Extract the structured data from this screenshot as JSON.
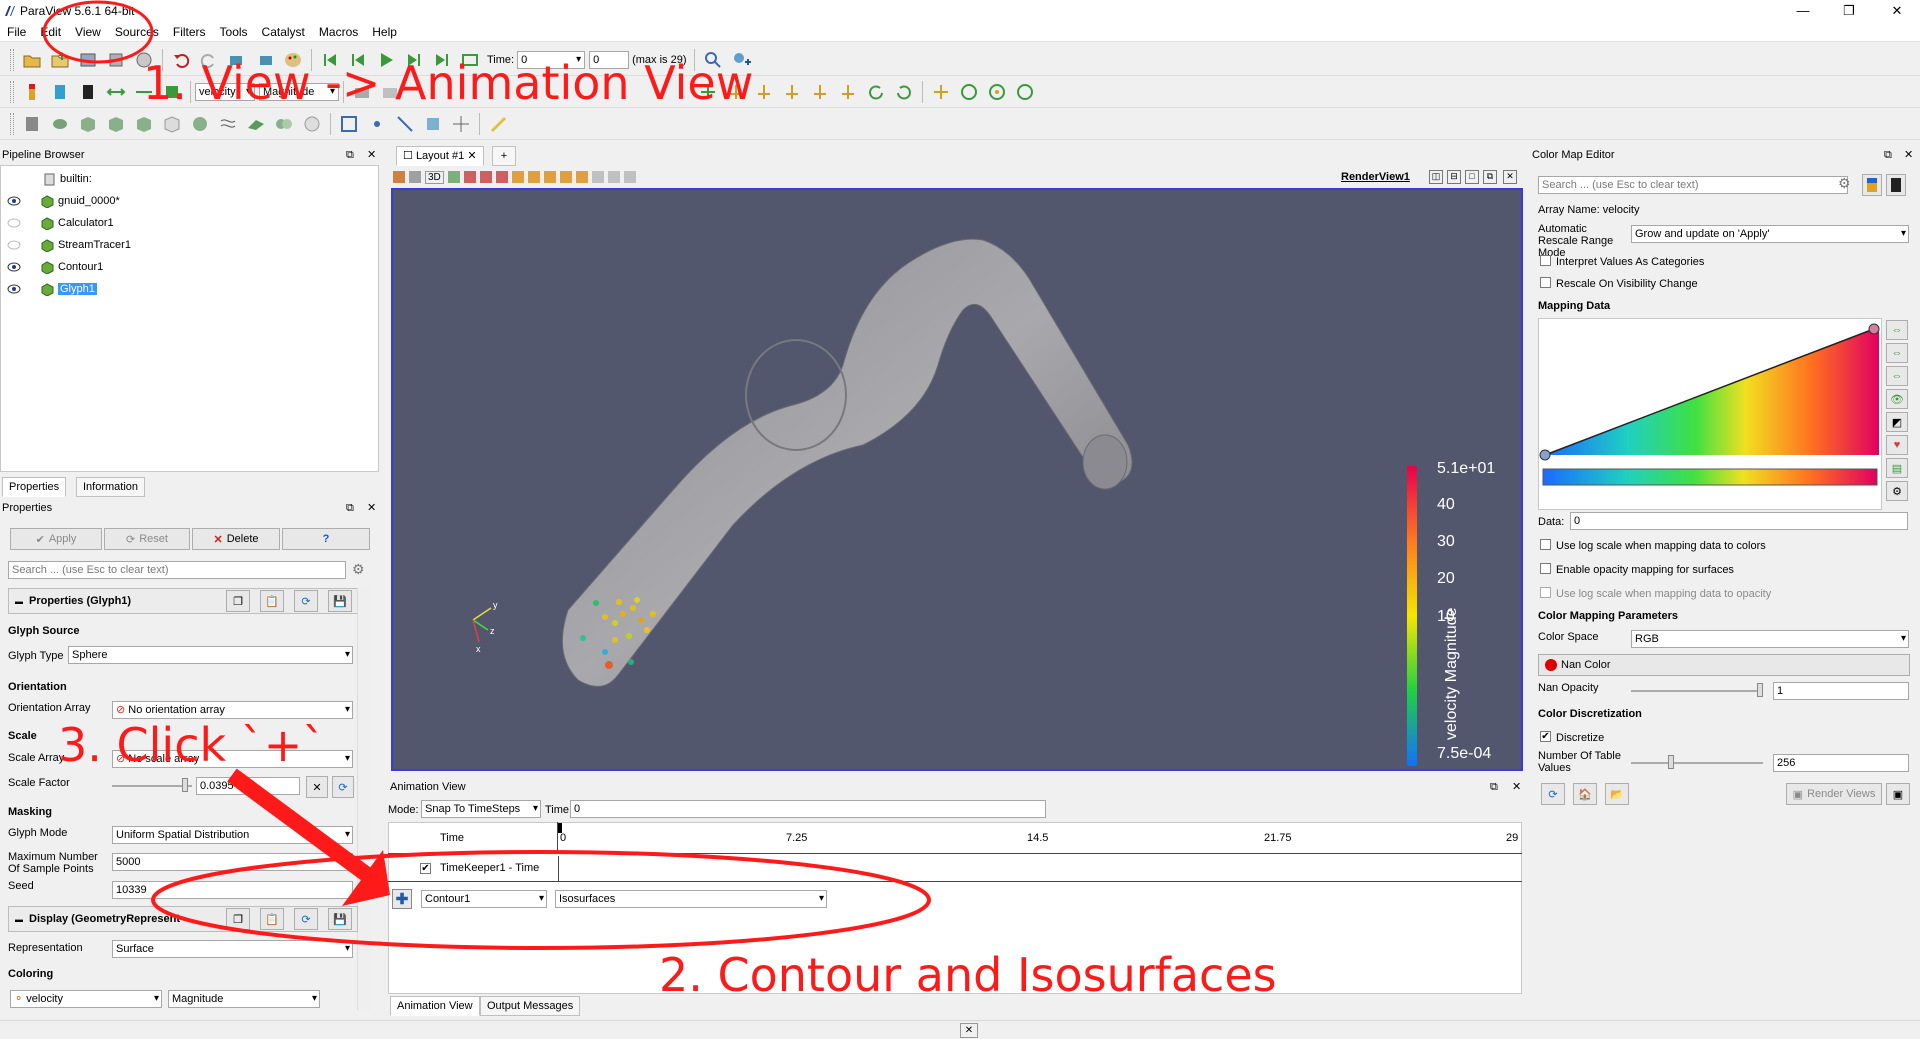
{
  "window": {
    "title": "ParaView 5.6.1 64-bit",
    "controls": [
      "—",
      "❐",
      "✕"
    ]
  },
  "menu": [
    "File",
    "Edit",
    "View",
    "Sources",
    "Filters",
    "Tools",
    "Catalyst",
    "Macros",
    "Help"
  ],
  "toolbar": {
    "time_label": "Time:",
    "time_value": "0",
    "timestep_value": "0",
    "max_label": "(max is 29)",
    "color_combo": "Magnitude"
  },
  "pipeline": {
    "title": "Pipeline Browser",
    "items": [
      {
        "label": "builtin:",
        "visible": null
      },
      {
        "label": "gnuid_0000*",
        "visible": true
      },
      {
        "label": "Calculator1",
        "visible": false
      },
      {
        "label": "StreamTracer1",
        "visible": false
      },
      {
        "label": "Contour1",
        "visible": true
      },
      {
        "label": "Glyph1",
        "visible": true,
        "selected": true
      }
    ]
  },
  "properties": {
    "tabs": [
      "Properties",
      "Information"
    ],
    "title": "Properties",
    "apply": "Apply",
    "reset": "Reset",
    "delete": "Delete",
    "help": "?",
    "search_placeholder": "Search ... (use Esc to clear text)",
    "group_title": "Properties (Glyph1)",
    "glyph_source_header": "Glyph Source",
    "glyph_type_label": "Glyph Type",
    "glyph_type_value": "Sphere",
    "orientation_header": "Orientation",
    "orientation_array_label": "Orientation Array",
    "orientation_array_value": "No orientation array",
    "scale_header": "Scale",
    "scale_array_label": "Scale Array",
    "scale_array_value": "No scale array",
    "scale_factor_label": "Scale Factor",
    "scale_factor_value": "0.0395",
    "masking_header": "Masking",
    "glyph_mode_label": "Glyph Mode",
    "glyph_mode_value": "Uniform Spatial Distribution",
    "max_points_label": "Maximum Number Of Sample Points",
    "max_points_value": "5000",
    "seed_label": "Seed",
    "seed_value": "10339",
    "display_title": "Display (GeometryRepresent",
    "representation_label": "Representation",
    "representation_value": "Surface",
    "coloring_header": "Coloring",
    "coloring_array": "velocity",
    "coloring_component": "Magnitude"
  },
  "layout": {
    "tab_label": "Layout #1",
    "add_tab": "+",
    "view_name": "RenderView1",
    "mode_3d": "3D"
  },
  "color_legend": {
    "title": "velocity Magnitude",
    "ticks": [
      "5.1e+01",
      "40",
      "30",
      "20",
      "10",
      "7.5e-04"
    ]
  },
  "animation": {
    "title": "Animation View",
    "mode_label": "Mode:",
    "mode_value": "Snap To TimeSteps",
    "time_label": "Time",
    "time_value": "0",
    "timeline_header": "Time",
    "timeline_ticks": [
      "0",
      "7.25",
      "14.5",
      "21.75",
      "29"
    ],
    "track_label": "TimeKeeper1 - Time",
    "source_combo": "Contour1",
    "property_combo": "Isosurfaces",
    "bottom_tabs": [
      "Animation View",
      "Output Messages"
    ]
  },
  "colormap": {
    "title": "Color Map Editor",
    "search_placeholder": "Search ... (use Esc to clear text)",
    "array_name": "Array Name: velocity",
    "auto_rescale_label": "Automatic Rescale Range Mode",
    "auto_rescale_value": "Grow and update on 'Apply'",
    "interpret_label": "Interpret Values As Categories",
    "rescale_visibility_label": "Rescale On Visibility Change",
    "mapping_data_header": "Mapping Data",
    "data_label": "Data:",
    "data_value": "0",
    "log_scale_label": "Use log scale when mapping data to colors",
    "opacity_mapping_label": "Enable opacity mapping for surfaces",
    "log_opacity_label": "Use log scale when mapping data to opacity",
    "color_mapping_header": "Color Mapping Parameters",
    "color_space_label": "Color Space",
    "color_space_value": "RGB",
    "nan_color_label": "Nan Color",
    "nan_opacity_label": "Nan Opacity",
    "nan_opacity_value": "1",
    "discretization_header": "Color Discretization",
    "discretize_label": "Discretize",
    "table_values_label": "Number Of Table Values",
    "table_values_value": "256",
    "render_views": "Render Views"
  },
  "annotations": {
    "step1": "1. View -> Animation View",
    "step2": "2. Contour and Isosurfaces",
    "step3": "3. Click `+`"
  },
  "colors": {
    "annotation": "#ff1a1a",
    "render_background": "#52576e",
    "selection": "#3399ff"
  }
}
